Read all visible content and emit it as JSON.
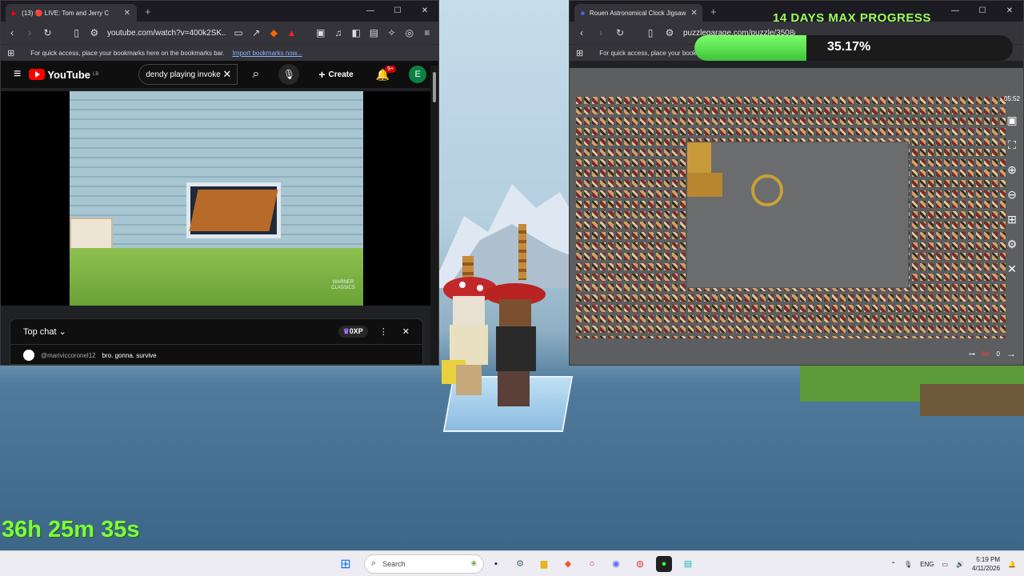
{
  "youtube_window": {
    "tab_title": "(13) 🔴 LIVE: Tom and Jerry C",
    "url": "youtube.com/watch?v=400k2SK...",
    "bookmarks_hint": "For quick access, place your bookmarks here on the bookmarks bar.",
    "bookmarks_link": "Import bookmarks now...",
    "logo": "YouTube",
    "logo_region": "LB",
    "search_value": "dendy playing invoke",
    "create_label": "Create",
    "notif_count": "9+",
    "avatar_letter": "E",
    "video_watermark": "WARNER CLASSICS",
    "chat_title": "Top chat",
    "chat_points": "0XP",
    "chat_user": "@mariviccoronel12",
    "chat_text": "bro. gonna. survive"
  },
  "puzzle_window": {
    "tab_title": "Rouen Astronomical Clock Jigsaw",
    "url": "puzzlegarage.com/puzzle/3508/",
    "bookmarks_hint": "For quick access, place your book",
    "puzzle_timer": "05:52",
    "footer_count": "0",
    "footer_label": "Mc"
  },
  "overlay": {
    "progress_title": "14 DAYS MAX PROGRESS",
    "progress_value": 0.3517,
    "progress_text": "35.17%",
    "stream_timer": "36h 25m 35s"
  },
  "taskbar": {
    "search_placeholder": "Search",
    "language": "ENG",
    "time": "5:19 PM",
    "date": "4/11/2026"
  },
  "colors": {
    "youtube_red": "#ff0000",
    "progress_green": "#3fc23a",
    "timer_green": "#7dff3a"
  }
}
